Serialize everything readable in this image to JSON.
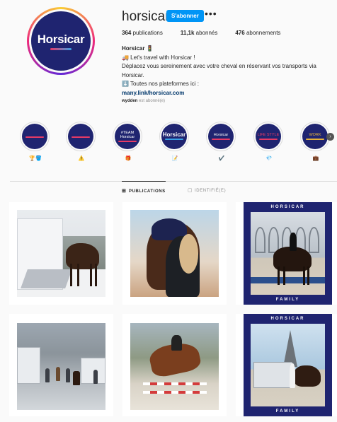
{
  "profile": {
    "username": "horsicar",
    "follow_label": "S'abonner",
    "more_label": "•••",
    "avatar_text": "Horsicar",
    "stats": {
      "posts_count": "364",
      "posts_label": "publications",
      "followers_count": "11,1k",
      "followers_label": "abonnés",
      "following_count": "476",
      "following_label": "abonnements"
    },
    "bio": {
      "name": "Horsicar 🚦",
      "line1": "🚚 Let's travel with Horsicar !",
      "line2": "Déplacez vous sereinement avec votre cheval en réservant vos transports via",
      "line3": "Horsicar.",
      "line4": "⬇️ Toutes nos plateformes ici :",
      "link": "many.link/horsicar.com"
    },
    "followed_by_name": "wydden",
    "followed_by_suffix": " est abonné(e)"
  },
  "highlights": [
    {
      "text": "",
      "label": "🏆🪣",
      "bar": "#e63a66"
    },
    {
      "text": "",
      "label": "⚠️",
      "bar": "#e63a66"
    },
    {
      "text": "#TEAM Horsicar",
      "label": "🎁",
      "bar": "#e63a66"
    },
    {
      "text": "Horsicar",
      "label": "📝",
      "bar": "#3aa0e6"
    },
    {
      "text": "Horsicar",
      "label": "✔️",
      "bar": "#e63a66"
    },
    {
      "text": "LIFE STYLE",
      "label": "💎",
      "bar": "#e63a66"
    },
    {
      "text": "WORK",
      "label": "💼",
      "bar": "#e6b23a"
    }
  ],
  "highlights_next": "›",
  "tabs": {
    "publications": "PUBLICATIONS",
    "tagged": "IDENTIFIÉ(E)"
  },
  "posts": {
    "frame_top": "HORSICAR",
    "frame_bottom": "FAMILY"
  }
}
